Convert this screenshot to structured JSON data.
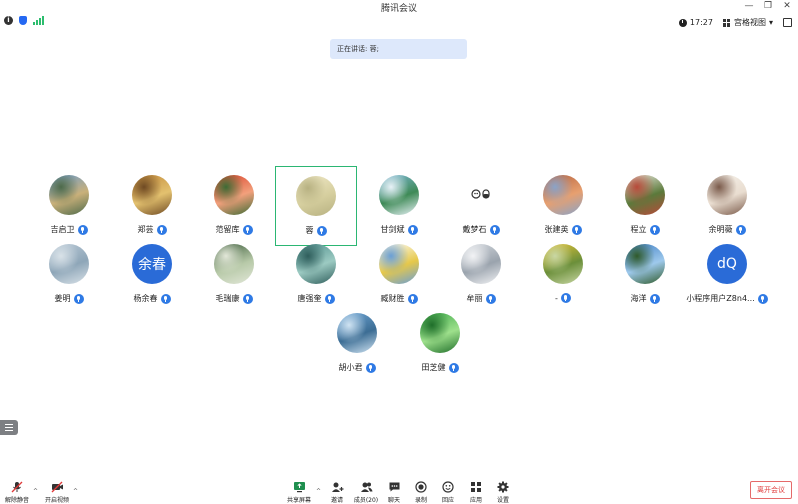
{
  "window": {
    "title": "腾讯会议"
  },
  "window_controls": {
    "minimize": "—",
    "restore": "❐",
    "close": "✕"
  },
  "status": {
    "time": "17:27",
    "view_mode": "宫格视图",
    "view_caret": "▾"
  },
  "speaking": {
    "text": "正在讲话: 蓉;"
  },
  "participants": [
    {
      "name": "吉启卫",
      "avatar": "photo-city",
      "colors": [
        "#6b9ccf",
        "#c9b07a",
        "#4d6a4a"
      ]
    },
    {
      "name": "郑芸",
      "avatar": "photo-autumn",
      "colors": [
        "#c28a3a",
        "#e3c16f",
        "#6f4a23"
      ]
    },
    {
      "name": "范留库",
      "avatar": "photo-flowers",
      "colors": [
        "#d9422b",
        "#f2a07c",
        "#3d6b35"
      ]
    },
    {
      "name": "蓉",
      "avatar": "photo-cat",
      "colors": [
        "#efe8c7",
        "#d6cf9f",
        "#b7b181"
      ],
      "active": true
    },
    {
      "name": "甘剑斌",
      "avatar": "photo-river",
      "colors": [
        "#7fb8d9",
        "#3e8a56",
        "#e8f2f7"
      ]
    },
    {
      "name": "戴梦石",
      "avatar": "cartoon",
      "colors": [
        "#ffffff",
        "#333333",
        "#333333"
      ]
    },
    {
      "name": "张建英",
      "avatar": "photo-canyon",
      "colors": [
        "#b5623e",
        "#e7a070",
        "#8aa3c8"
      ]
    },
    {
      "name": "程立",
      "avatar": "photo-plant",
      "colors": [
        "#f2eee6",
        "#5b7a3b",
        "#b84a3a"
      ]
    },
    {
      "name": "余明薇",
      "avatar": "photo-girl",
      "colors": [
        "#f5f1ea",
        "#e9ddd0",
        "#7a5a4a"
      ]
    },
    {
      "name": "姜明",
      "avatar": "photo-sea",
      "colors": [
        "#b9c9d6",
        "#8ea6b8",
        "#d9e2e8"
      ]
    },
    {
      "name": "杨余春",
      "avatar": "text",
      "avatar_text": "余春",
      "colors": [
        "#2a6bd7",
        "#2a6bd7",
        "#2a6bd7"
      ]
    },
    {
      "name": "毛瑞康",
      "avatar": "photo-cactus",
      "colors": [
        "#3a5a3a",
        "#b7c9a8",
        "#e2e7d8"
      ]
    },
    {
      "name": "唐强奎",
      "avatar": "photo-mist",
      "colors": [
        "#4f8f8c",
        "#9ccac2",
        "#2f5e5c"
      ]
    },
    {
      "name": "臧财胜",
      "avatar": "cartoon-flower",
      "colors": [
        "#ffffff",
        "#e6c84a",
        "#6a9fd6"
      ]
    },
    {
      "name": "牟丽",
      "avatar": "photo-anime",
      "colors": [
        "#d7dbe0",
        "#9aa3ad",
        "#f2f3f5"
      ]
    },
    {
      "name": "-",
      "avatar": "photo-sunflower",
      "colors": [
        "#e9c437",
        "#6b8f3a",
        "#c9d7a4"
      ]
    },
    {
      "name": "海洋",
      "avatar": "photo-ocean",
      "colors": [
        "#3f7ec4",
        "#9ec9ec",
        "#2f5a2a"
      ]
    },
    {
      "name": "小程序用户Z8n4...",
      "avatar": "text",
      "avatar_text": "dQ",
      "colors": [
        "#2a6bd7",
        "#2a6bd7",
        "#2a6bd7"
      ]
    },
    {
      "name": "胡小君",
      "avatar": "photo-lake",
      "colors": [
        "#6fa6d6",
        "#3c6d94",
        "#cfe3f2"
      ]
    },
    {
      "name": "田芝健",
      "avatar": "photo-leaf",
      "colors": [
        "#3da84a",
        "#9ee08c",
        "#1f6e2a"
      ]
    }
  ],
  "toolbar": {
    "unmute": "解除静音",
    "start_video": "开启视频",
    "share_screen": "共享屏幕",
    "invite": "邀请",
    "members": "成员(20)",
    "chat": "聊天",
    "record": "录制",
    "reactions": "回应",
    "apps": "应用",
    "settings": "设置",
    "leave": "离开会议",
    "caret": "^"
  }
}
